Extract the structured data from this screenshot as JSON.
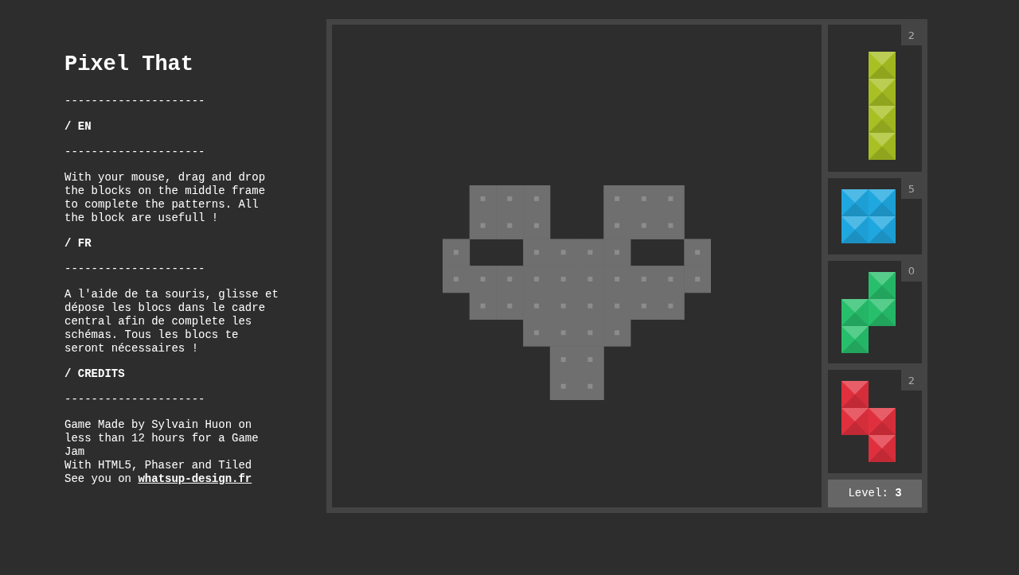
{
  "title": "Pixel That",
  "sections": [
    {
      "kind": "divider",
      "text": "---------------------"
    },
    {
      "kind": "heading",
      "text": "/ EN"
    },
    {
      "kind": "divider",
      "text": "---------------------"
    },
    {
      "kind": "paragraph",
      "text": "With your mouse, drag and drop the blocks on the middle frame to complete the patterns. All the block are usefull !"
    },
    {
      "kind": "heading",
      "text": "/ FR"
    },
    {
      "kind": "divider",
      "text": "---------------------"
    },
    {
      "kind": "paragraph",
      "text": "A l'aide de ta souris, glisse et dépose les blocs dans le cadre central afin de complete les schémas. Tous les blocs te seront nécessaires !"
    },
    {
      "kind": "heading",
      "text": "/ CREDITS"
    },
    {
      "kind": "divider",
      "text": "---------------------"
    },
    {
      "kind": "credits",
      "lines": [
        "Game Made by Sylvain Huon on less than 12 hours for a Game Jam",
        "With HTML5, Phaser and Tiled"
      ],
      "link_prefix": "See you on ",
      "link": "whatsup-design.fr"
    }
  ],
  "pieces": [
    {
      "count": "2",
      "color": "#a8c023"
    },
    {
      "count": "5",
      "color": "#1fa7e0"
    },
    {
      "count": "0",
      "color": "#27bf6c"
    },
    {
      "count": "2",
      "color": "#e0303e"
    }
  ],
  "level": {
    "label": "Level:",
    "value": "3"
  }
}
